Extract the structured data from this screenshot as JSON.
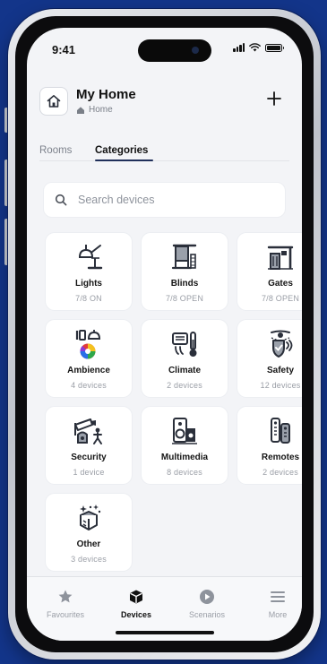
{
  "status_bar": {
    "time": "9:41"
  },
  "header": {
    "title": "My Home",
    "subtitle": "Home",
    "add_label": "+"
  },
  "tabs": [
    {
      "label": "Rooms",
      "active": false
    },
    {
      "label": "Categories",
      "active": true
    }
  ],
  "search": {
    "placeholder": "Search devices",
    "value": ""
  },
  "categories": [
    {
      "name": "Lights",
      "status": "7/8 ON",
      "icon": "lamp-icon"
    },
    {
      "name": "Blinds",
      "status": "7/8 OPEN",
      "icon": "blinds-icon"
    },
    {
      "name": "Gates",
      "status": "7/8 OPEN",
      "icon": "gate-icon"
    },
    {
      "name": "Ambience",
      "status": "4 devices",
      "icon": "ambience-icon"
    },
    {
      "name": "Climate",
      "status": "2 devices",
      "icon": "thermostat-icon"
    },
    {
      "name": "Safety",
      "status": "12 devices",
      "icon": "shield-icon"
    },
    {
      "name": "Security",
      "status": "1 device",
      "icon": "camera-icon"
    },
    {
      "name": "Multimedia",
      "status": "8 devices",
      "icon": "speaker-icon"
    },
    {
      "name": "Remotes",
      "status": "2 devices",
      "icon": "remote-icon"
    },
    {
      "name": "Other",
      "status": "3 devices",
      "icon": "sparkle-box-icon"
    }
  ],
  "tab_bar": [
    {
      "label": "Favourites",
      "icon": "star-icon",
      "active": false
    },
    {
      "label": "Devices",
      "icon": "cube-icon",
      "active": true
    },
    {
      "label": "Scenarios",
      "icon": "play-icon",
      "active": false
    },
    {
      "label": "More",
      "icon": "menu-icon",
      "active": false
    }
  ],
  "colors": {
    "background": "#13358a",
    "accent": "#1f2f5a",
    "screen": "#f3f4f7"
  }
}
